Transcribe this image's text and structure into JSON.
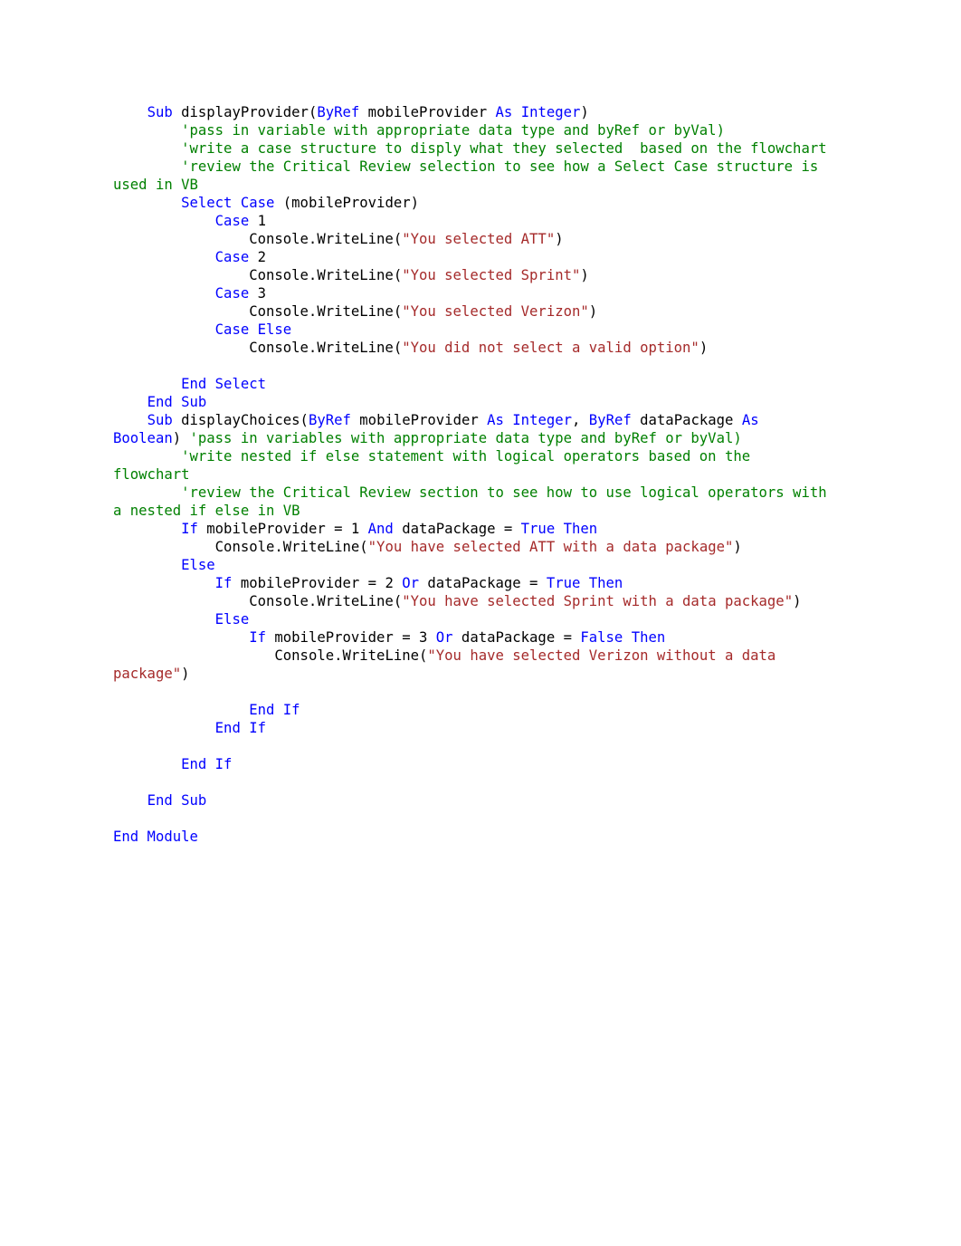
{
  "document": {
    "type": "source-code-listing",
    "language": "Visual Basic .NET",
    "page_background": "#ffffff",
    "syntax_colors": {
      "keyword": "#0000FF",
      "comment": "#008000",
      "string": "#A52A2A",
      "plain": "#000000"
    }
  },
  "code": {
    "lines": [
      {
        "id": "line-1",
        "tokens": [
          {
            "t": "pln",
            "v": "    "
          },
          {
            "t": "kw",
            "v": "Sub"
          },
          {
            "t": "pln",
            "v": " displayProvider("
          },
          {
            "t": "kw",
            "v": "ByRef"
          },
          {
            "t": "pln",
            "v": " mobileProvider "
          },
          {
            "t": "kw",
            "v": "As"
          },
          {
            "t": "pln",
            "v": " "
          },
          {
            "t": "kw",
            "v": "Integer"
          },
          {
            "t": "pln",
            "v": ")"
          }
        ]
      },
      {
        "id": "line-2",
        "tokens": [
          {
            "t": "pln",
            "v": "        "
          },
          {
            "t": "cmt",
            "v": "'pass in variable with appropriate data type and byRef or byVal)"
          }
        ]
      },
      {
        "id": "line-3",
        "tokens": [
          {
            "t": "pln",
            "v": "        "
          },
          {
            "t": "cmt",
            "v": "'write a case structure to disply what they selected  based on the flowchart"
          }
        ]
      },
      {
        "id": "line-4",
        "tokens": [
          {
            "t": "pln",
            "v": "        "
          },
          {
            "t": "cmt",
            "v": "'review the Critical Review selection to see how a Select Case structure is used in VB"
          }
        ]
      },
      {
        "id": "line-5",
        "tokens": [
          {
            "t": "pln",
            "v": "        "
          },
          {
            "t": "kw",
            "v": "Select Case"
          },
          {
            "t": "pln",
            "v": " (mobileProvider)"
          }
        ]
      },
      {
        "id": "line-6",
        "tokens": [
          {
            "t": "pln",
            "v": "            "
          },
          {
            "t": "kw",
            "v": "Case"
          },
          {
            "t": "pln",
            "v": " 1"
          }
        ]
      },
      {
        "id": "line-7",
        "tokens": [
          {
            "t": "pln",
            "v": "                Console.WriteLine("
          },
          {
            "t": "str",
            "v": "\"You selected ATT\""
          },
          {
            "t": "pln",
            "v": ")"
          }
        ]
      },
      {
        "id": "line-8",
        "tokens": [
          {
            "t": "pln",
            "v": "            "
          },
          {
            "t": "kw",
            "v": "Case"
          },
          {
            "t": "pln",
            "v": " 2"
          }
        ]
      },
      {
        "id": "line-9",
        "tokens": [
          {
            "t": "pln",
            "v": "                Console.WriteLine("
          },
          {
            "t": "str",
            "v": "\"You selected Sprint\""
          },
          {
            "t": "pln",
            "v": ")"
          }
        ]
      },
      {
        "id": "line-10",
        "tokens": [
          {
            "t": "pln",
            "v": "            "
          },
          {
            "t": "kw",
            "v": "Case"
          },
          {
            "t": "pln",
            "v": " 3"
          }
        ]
      },
      {
        "id": "line-11",
        "tokens": [
          {
            "t": "pln",
            "v": "                Console.WriteLine("
          },
          {
            "t": "str",
            "v": "\"You selected Verizon\""
          },
          {
            "t": "pln",
            "v": ")"
          }
        ]
      },
      {
        "id": "line-12",
        "tokens": [
          {
            "t": "pln",
            "v": "            "
          },
          {
            "t": "kw",
            "v": "Case Else"
          }
        ]
      },
      {
        "id": "line-13",
        "tokens": [
          {
            "t": "pln",
            "v": "                Console.WriteLine("
          },
          {
            "t": "str",
            "v": "\"You did not select a valid option\""
          },
          {
            "t": "pln",
            "v": ")"
          }
        ]
      },
      {
        "id": "line-14",
        "blank": true,
        "tokens": []
      },
      {
        "id": "line-15",
        "tokens": [
          {
            "t": "pln",
            "v": "        "
          },
          {
            "t": "kw",
            "v": "End Select"
          }
        ]
      },
      {
        "id": "line-16",
        "tokens": [
          {
            "t": "pln",
            "v": "    "
          },
          {
            "t": "kw",
            "v": "End Sub"
          }
        ]
      },
      {
        "id": "line-17",
        "tokens": [
          {
            "t": "pln",
            "v": "    "
          },
          {
            "t": "kw",
            "v": "Sub"
          },
          {
            "t": "pln",
            "v": " displayChoices("
          },
          {
            "t": "kw",
            "v": "ByRef"
          },
          {
            "t": "pln",
            "v": " mobileProvider "
          },
          {
            "t": "kw",
            "v": "As"
          },
          {
            "t": "pln",
            "v": " "
          },
          {
            "t": "kw",
            "v": "Integer"
          },
          {
            "t": "pln",
            "v": ", "
          },
          {
            "t": "kw",
            "v": "ByRef"
          },
          {
            "t": "pln",
            "v": " dataPackage "
          },
          {
            "t": "kw",
            "v": "As"
          },
          {
            "t": "pln",
            "v": " "
          },
          {
            "t": "kw",
            "v": "Boolean"
          },
          {
            "t": "pln",
            "v": ") "
          },
          {
            "t": "cmt",
            "v": "'pass in variables with appropriate data type and byRef or byVal)"
          }
        ]
      },
      {
        "id": "line-18",
        "tokens": [
          {
            "t": "pln",
            "v": "        "
          },
          {
            "t": "cmt",
            "v": "'write nested if else statement with logical operators based on the flowchart"
          }
        ]
      },
      {
        "id": "line-19",
        "tokens": [
          {
            "t": "pln",
            "v": "        "
          },
          {
            "t": "cmt",
            "v": "'review the Critical Review section to see how to use logical operators with a nested if else in VB"
          }
        ]
      },
      {
        "id": "line-20",
        "tokens": [
          {
            "t": "pln",
            "v": "        "
          },
          {
            "t": "kw",
            "v": "If"
          },
          {
            "t": "pln",
            "v": " mobileProvider = 1 "
          },
          {
            "t": "kw",
            "v": "And"
          },
          {
            "t": "pln",
            "v": " dataPackage = "
          },
          {
            "t": "kw",
            "v": "True Then"
          }
        ]
      },
      {
        "id": "line-21",
        "tokens": [
          {
            "t": "pln",
            "v": "            Console.WriteLine("
          },
          {
            "t": "str",
            "v": "\"You have selected ATT with a data package\""
          },
          {
            "t": "pln",
            "v": ")"
          }
        ]
      },
      {
        "id": "line-22",
        "tokens": [
          {
            "t": "pln",
            "v": "        "
          },
          {
            "t": "kw",
            "v": "Else"
          }
        ]
      },
      {
        "id": "line-23",
        "tokens": [
          {
            "t": "pln",
            "v": "            "
          },
          {
            "t": "kw",
            "v": "If"
          },
          {
            "t": "pln",
            "v": " mobileProvider = 2 "
          },
          {
            "t": "kw",
            "v": "Or"
          },
          {
            "t": "pln",
            "v": " dataPackage = "
          },
          {
            "t": "kw",
            "v": "True Then"
          }
        ]
      },
      {
        "id": "line-24",
        "tokens": [
          {
            "t": "pln",
            "v": "                Console.WriteLine("
          },
          {
            "t": "str",
            "v": "\"You have selected Sprint with a data package\""
          },
          {
            "t": "pln",
            "v": ")"
          }
        ]
      },
      {
        "id": "line-25",
        "tokens": [
          {
            "t": "pln",
            "v": "            "
          },
          {
            "t": "kw",
            "v": "Else"
          }
        ]
      },
      {
        "id": "line-26",
        "tokens": [
          {
            "t": "pln",
            "v": "                "
          },
          {
            "t": "kw",
            "v": "If"
          },
          {
            "t": "pln",
            "v": " mobileProvider = 3 "
          },
          {
            "t": "kw",
            "v": "Or"
          },
          {
            "t": "pln",
            "v": " dataPackage = "
          },
          {
            "t": "kw",
            "v": "False Then"
          }
        ]
      },
      {
        "id": "line-27",
        "tokens": [
          {
            "t": "pln",
            "v": "                   Console.WriteLine("
          },
          {
            "t": "str",
            "v": "\"You have selected Verizon without a data package\""
          },
          {
            "t": "pln",
            "v": ")"
          }
        ]
      },
      {
        "id": "line-28",
        "blank": true,
        "tokens": []
      },
      {
        "id": "line-29",
        "tokens": [
          {
            "t": "pln",
            "v": "                "
          },
          {
            "t": "kw",
            "v": "End If"
          }
        ]
      },
      {
        "id": "line-30",
        "tokens": [
          {
            "t": "pln",
            "v": "            "
          },
          {
            "t": "kw",
            "v": "End If"
          }
        ]
      },
      {
        "id": "line-31",
        "blank": true,
        "tokens": []
      },
      {
        "id": "line-32",
        "tokens": [
          {
            "t": "pln",
            "v": "        "
          },
          {
            "t": "kw",
            "v": "End If"
          }
        ]
      },
      {
        "id": "line-33",
        "blank": true,
        "tokens": []
      },
      {
        "id": "line-34",
        "tokens": [
          {
            "t": "pln",
            "v": "    "
          },
          {
            "t": "kw",
            "v": "End Sub"
          }
        ]
      },
      {
        "id": "line-35",
        "blank": true,
        "tokens": []
      },
      {
        "id": "line-36",
        "tokens": [
          {
            "t": "kw",
            "v": "End Module"
          }
        ]
      }
    ]
  }
}
